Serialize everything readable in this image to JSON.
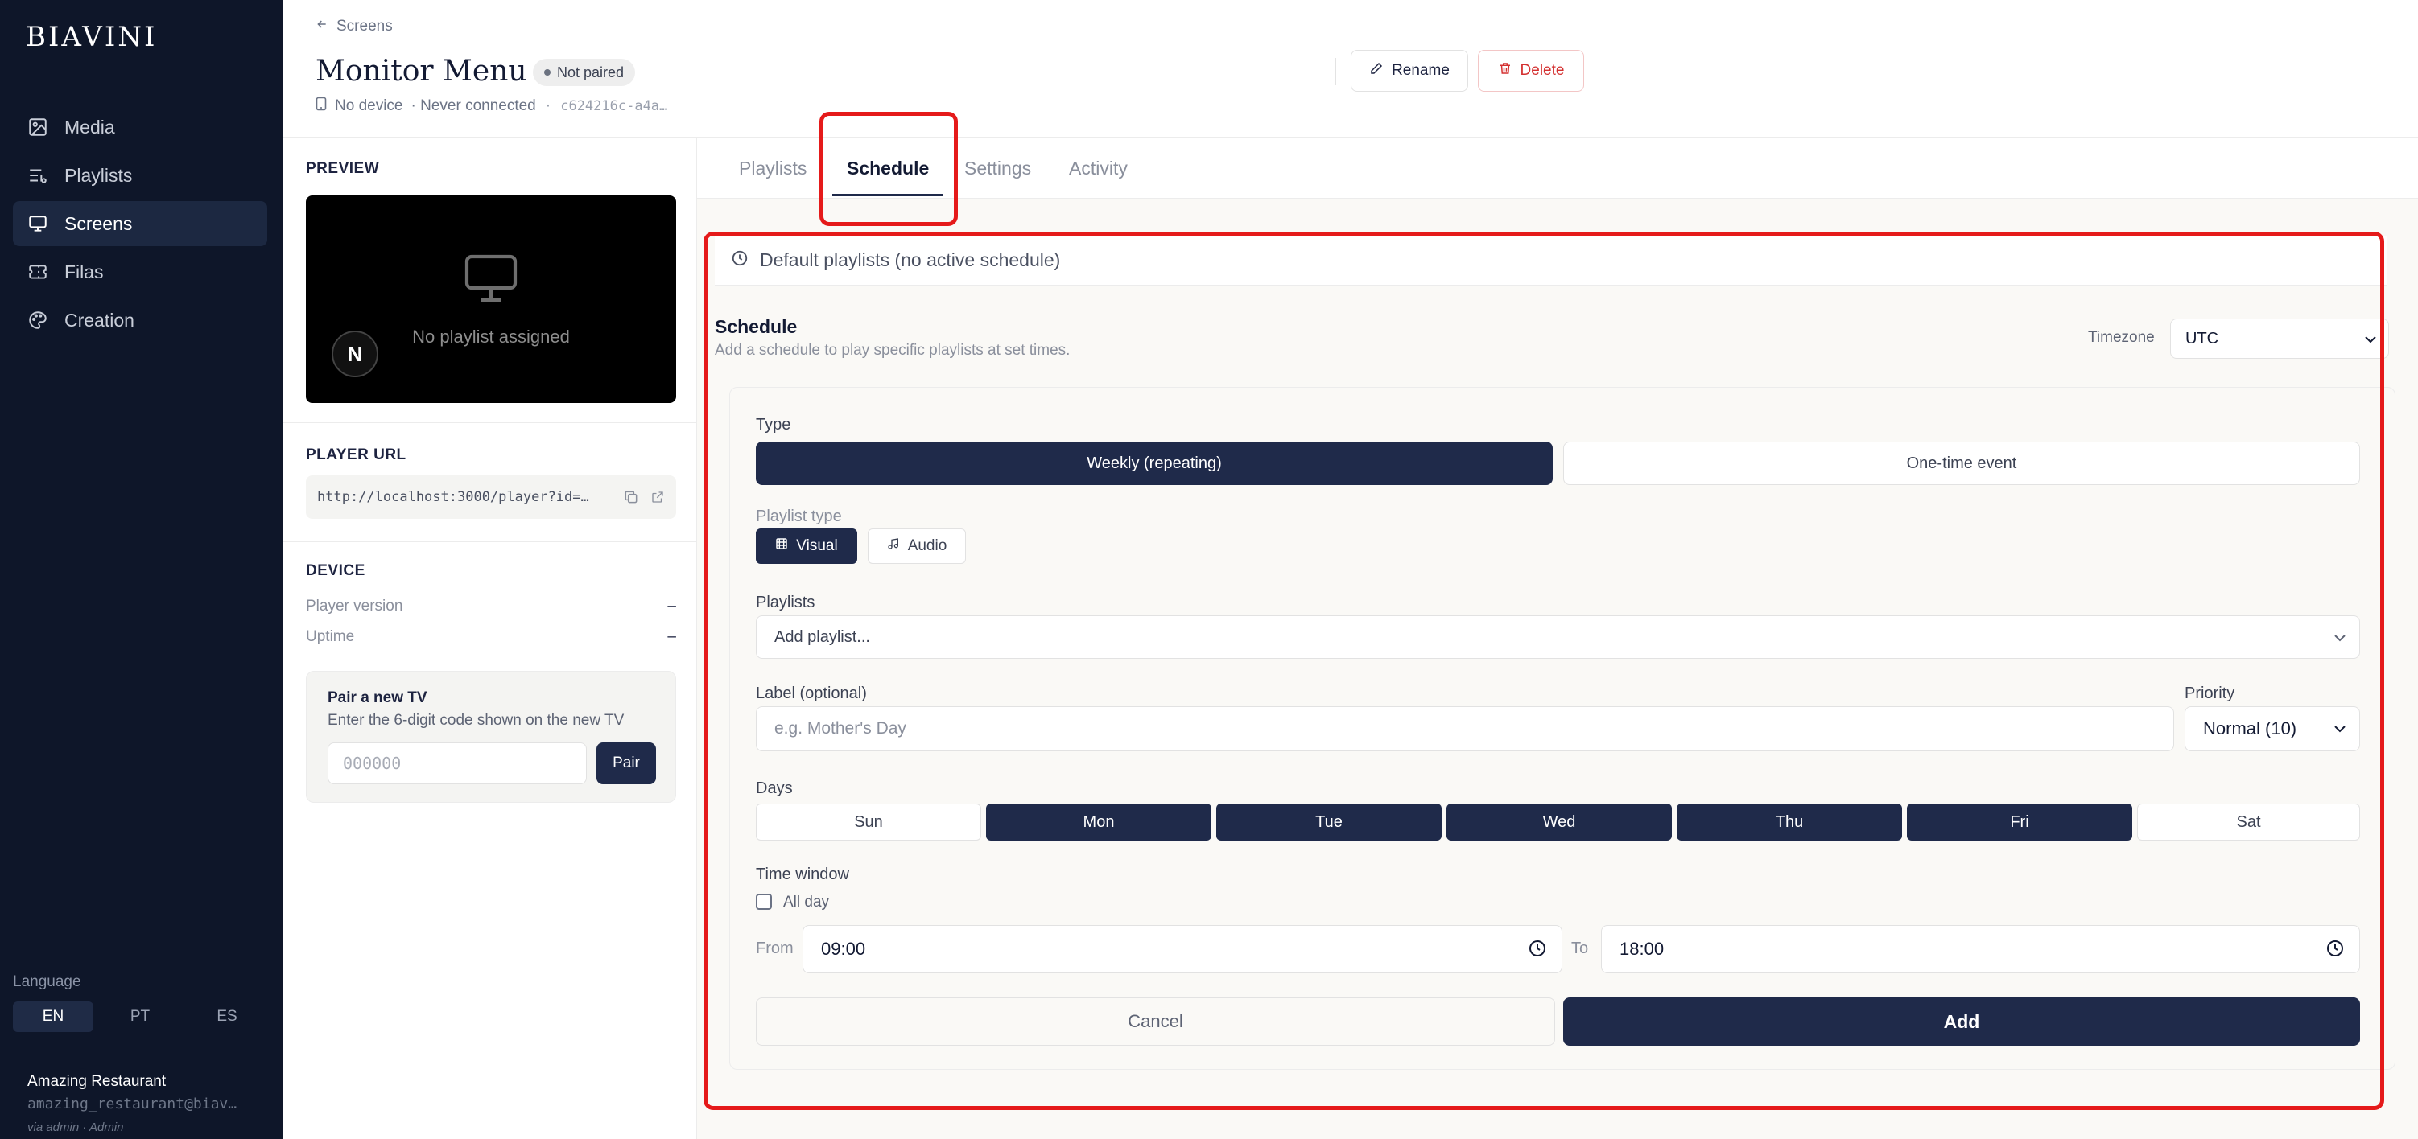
{
  "sidebar": {
    "logo": "BIAVINI",
    "items": [
      {
        "label": "Media",
        "icon": "image-icon"
      },
      {
        "label": "Playlists",
        "icon": "playlist-icon"
      },
      {
        "label": "Screens",
        "icon": "monitor-icon",
        "active": true
      },
      {
        "label": "Filas",
        "icon": "ticket-icon"
      },
      {
        "label": "Creation",
        "icon": "palette-icon"
      }
    ],
    "language_label": "Language",
    "languages": [
      "EN",
      "PT",
      "ES"
    ],
    "active_language": "EN",
    "account": {
      "name": "Amazing Restaurant",
      "email": "amazing_restaurant@biav…",
      "role": "via admin · Admin"
    }
  },
  "header": {
    "back_label": "Screens",
    "title": "Monitor Menu",
    "status_badge": "Not paired",
    "device": "No device",
    "connection": "· Never connected",
    "id_short": "· c624216c-a4a…",
    "rename_label": "Rename",
    "delete_label": "Delete"
  },
  "left_panel": {
    "preview_title": "PREVIEW",
    "preview_text": "No playlist assigned",
    "preview_avatar": "N",
    "player_url_title": "PLAYER URL",
    "player_url": "http://localhost:3000/player?id=…",
    "device_title": "DEVICE",
    "device_rows": [
      {
        "label": "Player version",
        "value": "–"
      },
      {
        "label": "Uptime",
        "value": "–"
      }
    ],
    "pair": {
      "title": "Pair a new TV",
      "subtitle": "Enter the 6-digit code shown on the new TV",
      "placeholder": "000000",
      "button": "Pair"
    }
  },
  "tabs": [
    {
      "label": "Playlists"
    },
    {
      "label": "Schedule",
      "active": true
    },
    {
      "label": "Settings"
    },
    {
      "label": "Activity"
    }
  ],
  "schedule": {
    "banner": "Default playlists (no active schedule)",
    "title": "Schedule",
    "subtitle": "Add a schedule to play specific playlists at set times.",
    "timezone_label": "Timezone",
    "timezone_value": "UTC",
    "form": {
      "type_label": "Type",
      "type_options": [
        "Weekly (repeating)",
        "One-time event"
      ],
      "type_selected": "Weekly (repeating)",
      "playlist_type_label": "Playlist type",
      "playlist_type_options": [
        "Visual",
        "Audio"
      ],
      "playlist_type_selected": "Visual",
      "playlists_label": "Playlists",
      "playlists_placeholder": "Add playlist...",
      "label_label": "Label (optional)",
      "label_placeholder": "e.g. Mother's Day",
      "priority_label": "Priority",
      "priority_value": "Normal (10)",
      "days_label": "Days",
      "days": [
        {
          "label": "Sun",
          "on": false
        },
        {
          "label": "Mon",
          "on": true
        },
        {
          "label": "Tue",
          "on": true
        },
        {
          "label": "Wed",
          "on": true
        },
        {
          "label": "Thu",
          "on": true
        },
        {
          "label": "Fri",
          "on": true
        },
        {
          "label": "Sat",
          "on": false
        }
      ],
      "time_window_label": "Time window",
      "all_day_label": "All day",
      "all_day_checked": false,
      "from_label": "From",
      "from_value": "09:00",
      "to_label": "To",
      "to_value": "18:00",
      "cancel_label": "Cancel",
      "add_label": "Add"
    }
  },
  "colors": {
    "sidebar_bg": "#0e1629",
    "accent": "#1f2a4a",
    "danger": "#d43030",
    "highlight": "#e51a1a"
  }
}
